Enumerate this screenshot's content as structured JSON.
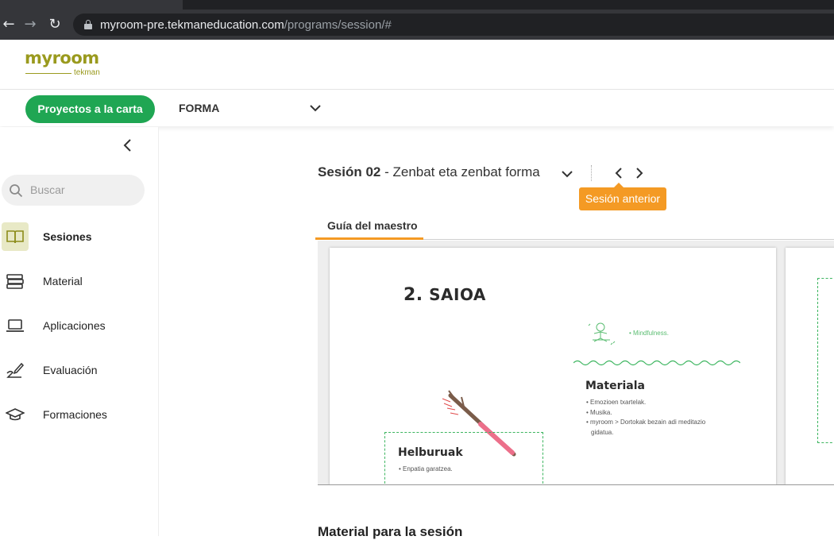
{
  "browser": {
    "url_host": "myroom-pre.tekmaneducation.com",
    "url_path": "/programs/session/#",
    "back_icon": "arrow-left-icon",
    "forward_icon": "arrow-right-icon",
    "reload_icon": "reload-icon"
  },
  "header": {
    "logo_word": "myroom",
    "logo_sub": "tekman",
    "brand_color": "#9a9a1e"
  },
  "program_bar": {
    "program_pill": "Proyectos a la carta",
    "selected_project": "FORMA",
    "pill_color": "#1fa653"
  },
  "sidebar": {
    "search_placeholder": "Buscar",
    "items": [
      {
        "label": "Sesiones",
        "icon": "book-icon",
        "active": true
      },
      {
        "label": "Material",
        "icon": "stack-icon",
        "active": false
      },
      {
        "label": "Aplicaciones",
        "icon": "laptop-icon",
        "active": false
      },
      {
        "label": "Evaluación",
        "icon": "pen-icon",
        "active": false
      },
      {
        "label": "Formaciones",
        "icon": "graduation-cap-icon",
        "active": false
      }
    ]
  },
  "session": {
    "number": "Sesión 02",
    "name": " - Zenbat eta zenbat forma",
    "tooltip": "Sesión anterior",
    "accent_color": "#f49a24"
  },
  "tabs": {
    "guide": "Guía del maestro"
  },
  "document": {
    "saioa_number": "2.",
    "saioa_word": "SAIOA",
    "mindfulness": "• Mindfulness.",
    "materiala_title": "Materiala",
    "materiala_items": [
      "• Emozioen txartelak.",
      "• Musika.",
      "• myroom > Dortokak bezain adi meditazio",
      "gidatua."
    ],
    "helburuak_title": "Helburuak",
    "helburuak_item": "• Enpatia garatzea."
  },
  "section": {
    "material_heading": "Material para la sesión"
  }
}
